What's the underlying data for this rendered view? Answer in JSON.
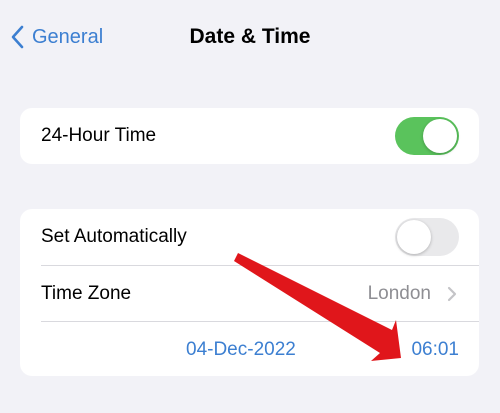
{
  "nav": {
    "back_label": "General",
    "title": "Date & Time"
  },
  "section1": {
    "hour24_label": "24-Hour Time",
    "hour24_on": true
  },
  "section2": {
    "set_auto_label": "Set Automatically",
    "set_auto_on": false,
    "timezone_label": "Time Zone",
    "timezone_value": "London",
    "date_value": "04-Dec-2022",
    "time_value": "06:01"
  },
  "colors": {
    "accent": "#3c7fd1",
    "toggle_on": "#5ac35c",
    "annotation_arrow": "#e0161b"
  },
  "icons": [
    "chevron-left-icon",
    "chevron-right-icon",
    "annotation-arrow"
  ]
}
